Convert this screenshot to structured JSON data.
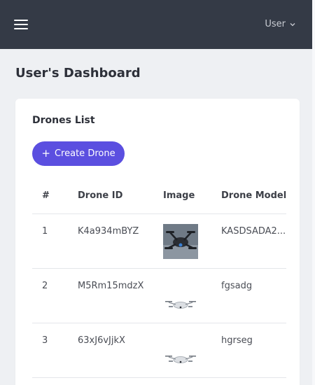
{
  "header": {
    "user_label": "User"
  },
  "page": {
    "title": "User's Dashboard"
  },
  "card": {
    "title": "Drones List",
    "create_button_label": "Create Drone"
  },
  "table": {
    "columns": [
      "#",
      "Drone ID",
      "Image",
      "Drone Model"
    ],
    "rows": [
      {
        "index": "1",
        "drone_id": "K4a934mBYZ",
        "image": "dark quadcopter photo",
        "model": "KASDSADA2..."
      },
      {
        "index": "2",
        "drone_id": "M5Rm15mdzX",
        "image": "white drone photo",
        "model": "fgsadg"
      },
      {
        "index": "3",
        "drone_id": "63xJ6vJjkX",
        "image": "white drone photo",
        "model": "hgrseg"
      }
    ]
  },
  "colors": {
    "topbar": "#343a46",
    "accent": "#5b4fe0",
    "background": "#eef0f3"
  }
}
